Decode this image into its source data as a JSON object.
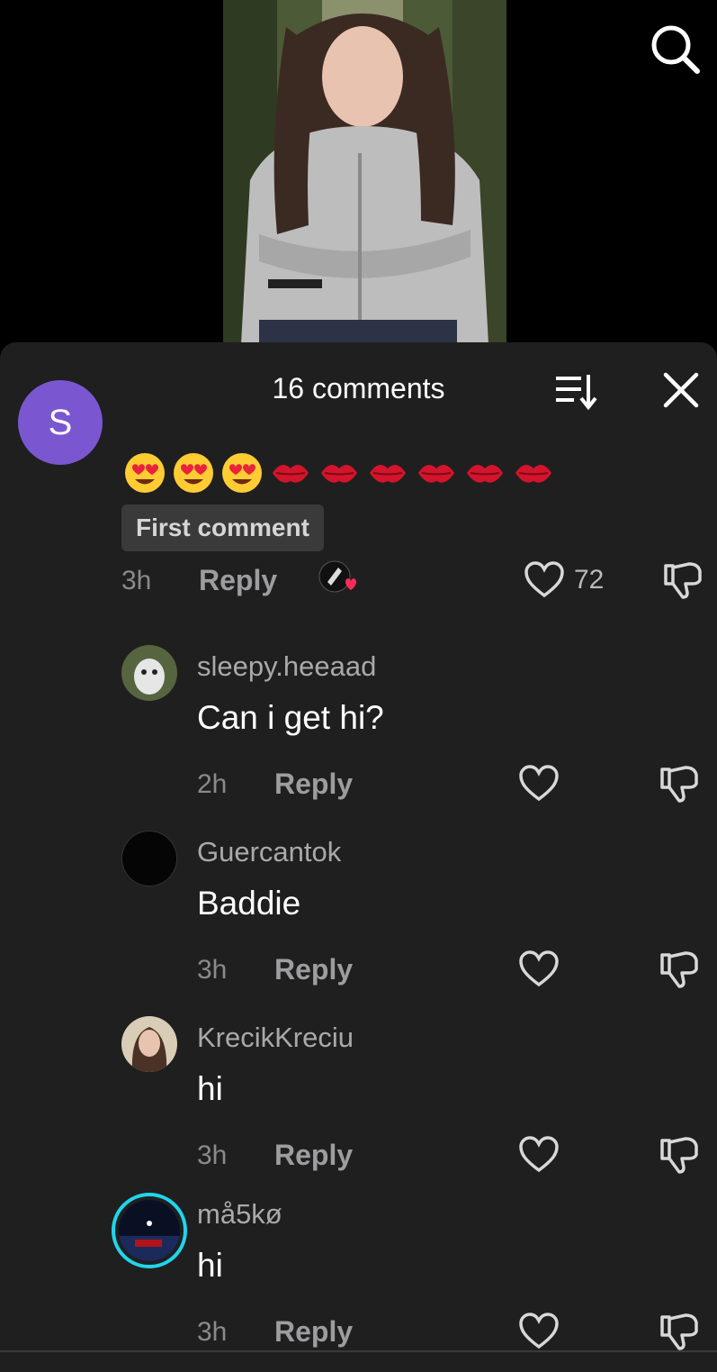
{
  "header": {
    "comment_count": "16 comments"
  },
  "icons": {
    "search": "search-icon",
    "sort": "sort-icon",
    "close": "close-icon",
    "like": "heart-icon",
    "dislike": "thumbs-down-icon"
  },
  "colors": {
    "sheet_background": "#1f1f20",
    "avatar_purple": "#7a57d1",
    "like_heart_red": "#fe2c55",
    "story_ring": "#20d5ec"
  },
  "top_comment": {
    "avatar_letter": "S",
    "text_emojis": "😍😍😍💋💋💋💋💋💋",
    "badge": "First comment",
    "time": "3h",
    "reply_label": "Reply",
    "like_count": "72"
  },
  "replies": [
    {
      "username": "sleepy.heeaad",
      "text": "Can i get hi?",
      "time": "2h",
      "reply_label": "Reply"
    },
    {
      "username": "Guercantok",
      "text": "Baddie",
      "time": "3h",
      "reply_label": "Reply"
    },
    {
      "username": "KrecikKreciu",
      "text": "hi",
      "time": "3h",
      "reply_label": "Reply"
    },
    {
      "username": "må5kø",
      "text": "hi",
      "time": "3h",
      "reply_label": "Reply"
    }
  ]
}
